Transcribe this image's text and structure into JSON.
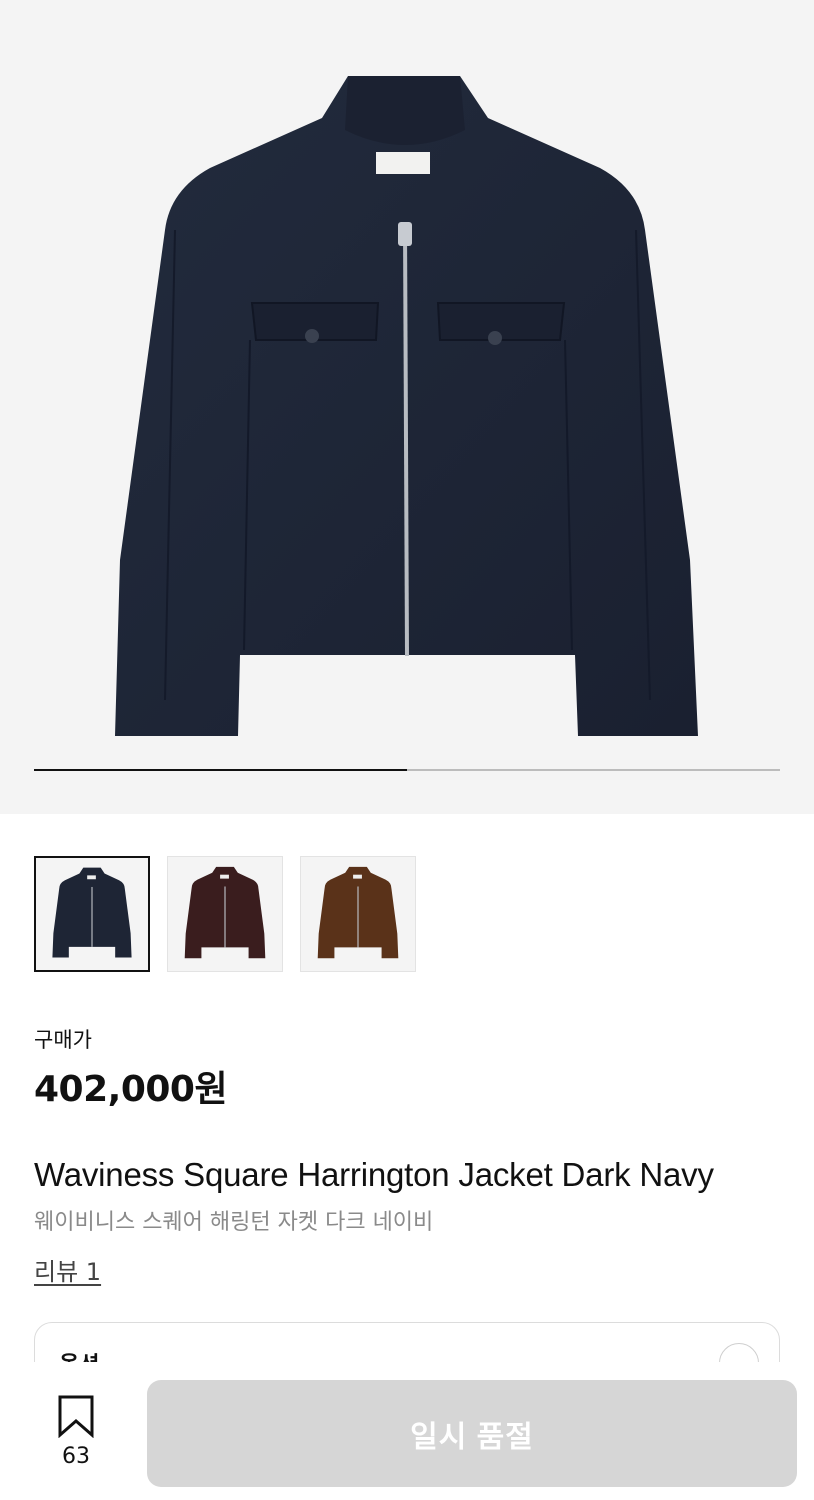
{
  "gallery": {
    "current_slide": 1,
    "total_slides": 2,
    "progress": 0.5
  },
  "thumbnails": [
    {
      "color": "#1e2535",
      "selected": true
    },
    {
      "color": "#3a1d1e",
      "selected": false
    },
    {
      "color": "#5a3219",
      "selected": false
    }
  ],
  "price": {
    "label": "구매가",
    "value": "402,000원"
  },
  "product": {
    "name_en": "Waviness Square Harrington Jacket Dark Navy",
    "name_ko": "웨이비니스 스퀘어 해링턴 자켓 다크 네이비",
    "review_label": "리뷰 1"
  },
  "option": {
    "label": "옵션"
  },
  "bottom_bar": {
    "bookmark_count": "63",
    "soldout_label": "일시 품절"
  },
  "colors": {
    "jacket_navy": "#1e2535",
    "button_disabled": "#d6d6d6"
  }
}
